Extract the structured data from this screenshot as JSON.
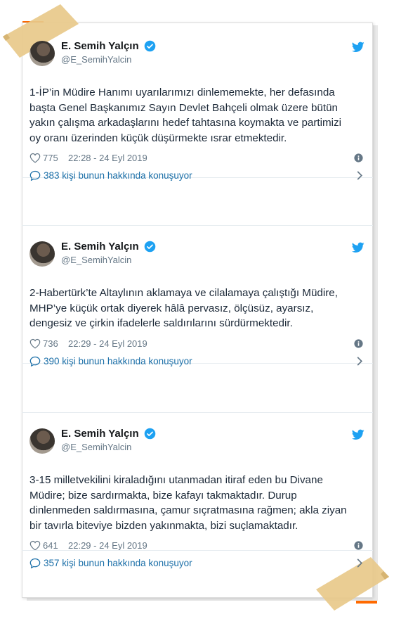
{
  "colors": {
    "accent": "#1da1f2",
    "link": "#1b6fa8",
    "frame": "#ff6a00",
    "tape": "#e8c98a"
  },
  "tweets": [
    {
      "author": {
        "name": "E. Semih Yalçın",
        "handle": "@E_SemihYalcin"
      },
      "text": "1-İP’in Müdire Hanımı uyarılarımızı dinlememekte, her defasında\nbaşta Genel Başkanımız Sayın Devlet Bahçeli olmak üzere bütün\nyakın çalışma arkadaşlarını hedef tahtasına koymakta ve partimizi\noy oranı üzerinden küçük düşürmekte ısrar etmektedir.",
      "likes": "775",
      "time": "22:28 - 24 Eyl 2019",
      "conversation": "383 kişi bunun hakkında konuşuyor"
    },
    {
      "author": {
        "name": "E. Semih Yalçın",
        "handle": "@E_SemihYalcin"
      },
      "text": "2-Habertürk’te Altaylının aklamaya ve cilalamaya çalıştığı Müdire,\nMHP’ye küçük ortak diyerek hâlâ pervasız, ölçüsüz, ayarsız,\ndengesiz ve çirkin ifadelerle saldırılarını sürdürmektedir.",
      "likes": "736",
      "time": "22:29 - 24 Eyl 2019",
      "conversation": "390 kişi bunun hakkında konuşuyor"
    },
    {
      "author": {
        "name": "E. Semih Yalçın",
        "handle": "@E_SemihYalcin"
      },
      "text": "3-15 milletvekilini kiraladığını utanmadan itiraf eden bu Divane\nMüdire; bize sardırmakta, bize kafayı takmaktadır. Durup\ndinlenmeden saldırmasına, çamur sıçratmasına rağmen; akla ziyan\nbir tavırla biteviye bizden yakınmakta, bizi suçlamaktadır.",
      "likes": "641",
      "time": "22:29 - 24 Eyl 2019",
      "conversation": "357 kişi bunun hakkında konuşuyor"
    }
  ]
}
